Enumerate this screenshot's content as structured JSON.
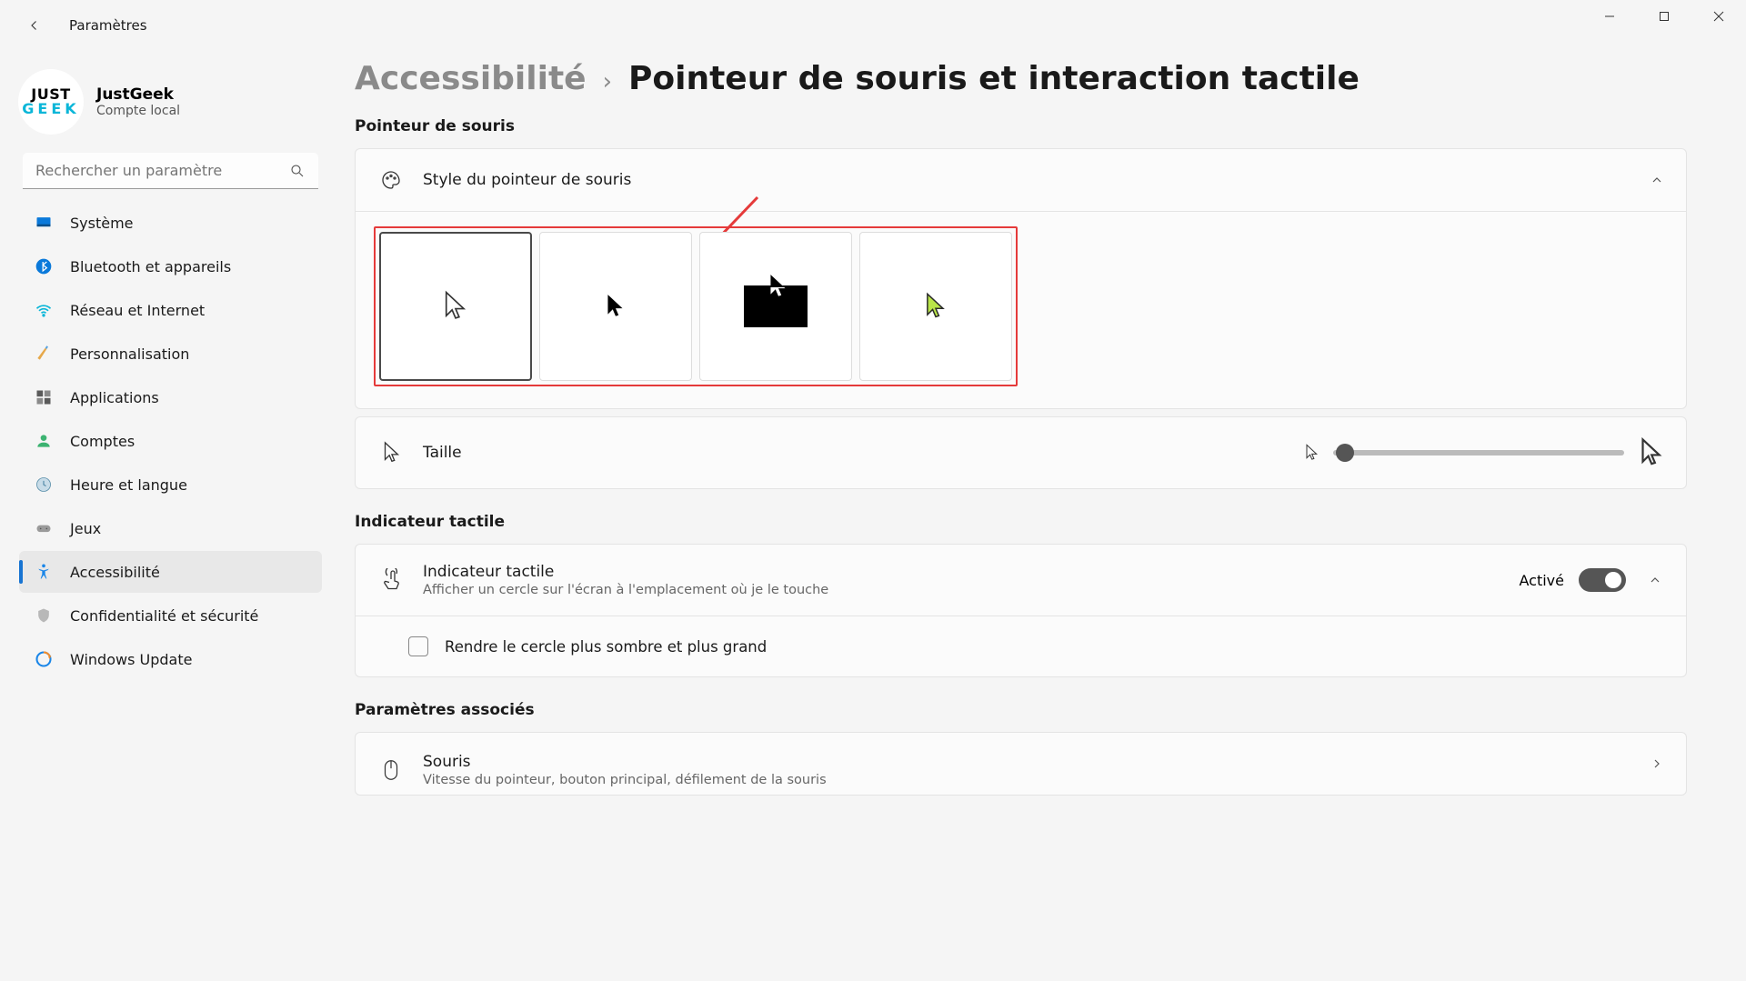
{
  "window": {
    "app_title": "Paramètres"
  },
  "user": {
    "logo_l1": "JUST",
    "logo_l2": "GEEK",
    "name": "JustGeek",
    "subtitle": "Compte local"
  },
  "search": {
    "placeholder": "Rechercher un paramètre"
  },
  "sidebar": {
    "items": [
      {
        "label": "Système"
      },
      {
        "label": "Bluetooth et appareils"
      },
      {
        "label": "Réseau et Internet"
      },
      {
        "label": "Personnalisation"
      },
      {
        "label": "Applications"
      },
      {
        "label": "Comptes"
      },
      {
        "label": "Heure et langue"
      },
      {
        "label": "Jeux"
      },
      {
        "label": "Accessibilité"
      },
      {
        "label": "Confidentialité et sécurité"
      },
      {
        "label": "Windows Update"
      }
    ],
    "active_index": 8
  },
  "breadcrumb": {
    "parent": "Accessibilité",
    "separator": "›",
    "current": "Pointeur de souris et interaction tactile"
  },
  "sections": {
    "pointer": {
      "title": "Pointeur de souris",
      "style_row_label": "Style du pointeur de souris",
      "size_label": "Taille",
      "style_options": [
        "white",
        "black",
        "inverted",
        "custom"
      ],
      "selected_style_index": 0,
      "size_value_percent": 4
    },
    "touch": {
      "title": "Indicateur tactile",
      "row_title": "Indicateur tactile",
      "row_sub": "Afficher un cercle sur l'écran à l'emplacement où je le touche",
      "state_label": "Activé",
      "enabled": true,
      "checkbox_label": "Rendre le cercle plus sombre et plus grand",
      "checkbox_checked": false
    },
    "related": {
      "title": "Paramètres associés",
      "mouse_label": "Souris",
      "mouse_sub": "Vitesse du pointeur, bouton principal, défilement de la souris"
    }
  }
}
